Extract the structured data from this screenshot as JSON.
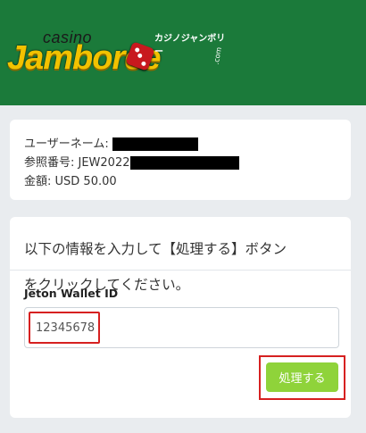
{
  "brand": {
    "casino": "casino",
    "name": "Jamboree",
    "kana": "カジノジャンボリー",
    "suffix": ".com"
  },
  "info": {
    "username_label": "ユーザーネーム:",
    "reference_label": "参照番号: JEW2022",
    "amount_label": "金額: USD 50.00"
  },
  "form": {
    "instruction_line1": "以下の情報を入力して【処理する】ボタン",
    "instruction_line2": "をクリックしてください。",
    "field_label": "Jeton Wallet ID",
    "field_value": "12345678",
    "submit_label": "処理する"
  },
  "colors": {
    "header_bg": "#1b7a3a",
    "button_bg": "#8fd33a",
    "highlight": "#d62020"
  }
}
